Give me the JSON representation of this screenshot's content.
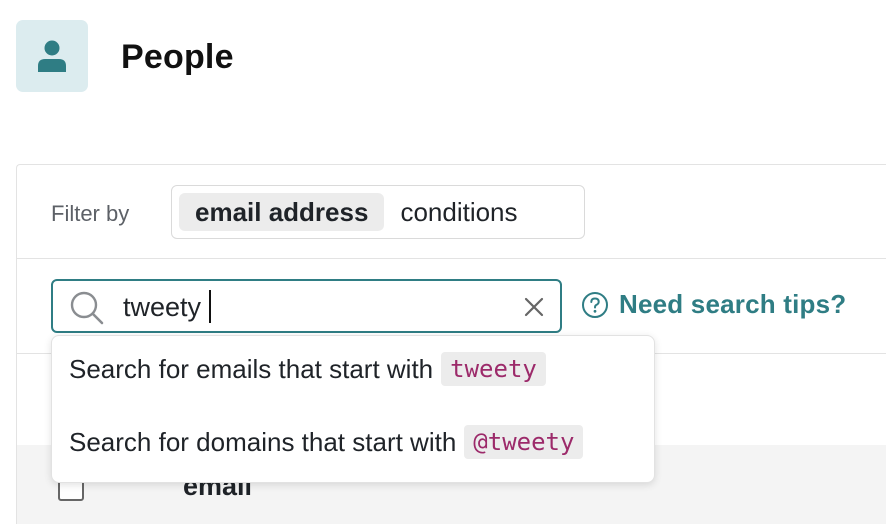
{
  "header": {
    "title": "People",
    "icon": "person-icon"
  },
  "filter": {
    "label": "Filter by",
    "options": [
      {
        "label": "email address",
        "active": true
      },
      {
        "label": "conditions",
        "active": false
      }
    ]
  },
  "search": {
    "value": "tweety",
    "placeholder": "",
    "tips_label": "Need search tips?"
  },
  "suggestions": [
    {
      "text": "Search for emails that start with",
      "code": "tweety"
    },
    {
      "text": "Search for domains that start with",
      "code": "@tweety"
    }
  ],
  "table": {
    "columns": [
      "email"
    ]
  },
  "colors": {
    "accent": "#2f7d84",
    "code_text": "#9c2a6a",
    "avatar_bg": "#dcecef"
  }
}
